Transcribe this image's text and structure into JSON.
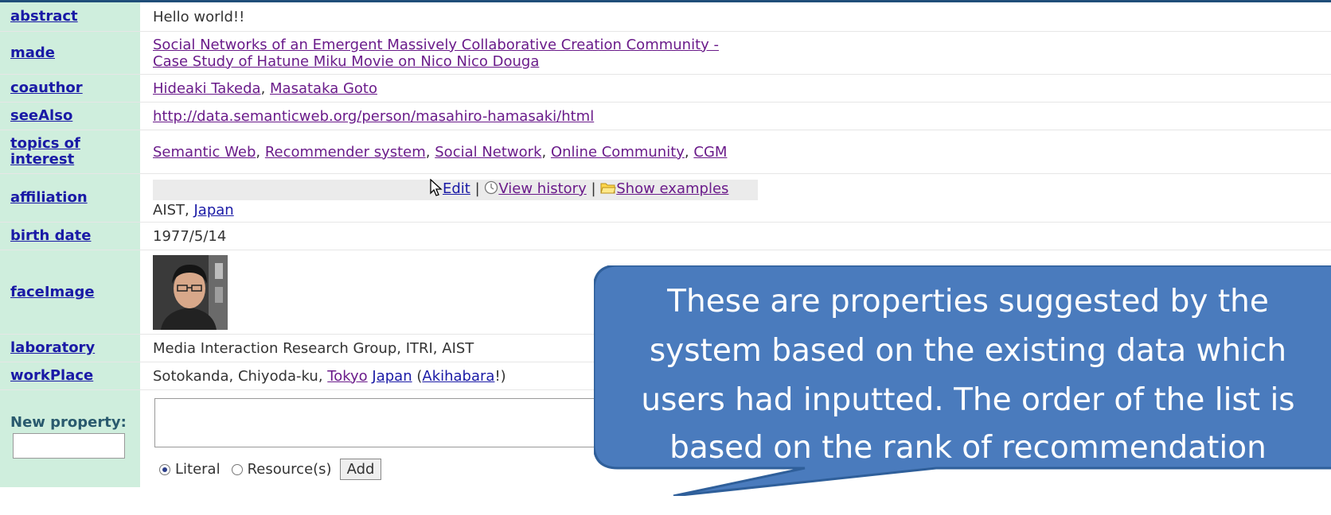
{
  "rows": {
    "abstract": {
      "label": "abstract",
      "value": "Hello world!!"
    },
    "made": {
      "label": "made",
      "line1": "Social Networks of an Emergent Massively Collaborative Creation Community -",
      "line2": "Case Study of Hatune Miku Movie on Nico Nico Douga"
    },
    "coauthor": {
      "label": "coauthor",
      "a1": "Hideaki Takeda",
      "sep": ", ",
      "a2": "Masataka Goto"
    },
    "seeAlso": {
      "label": "seeAlso",
      "url": "http://data.semanticweb.org/person/masahiro-hamasaki/html"
    },
    "topics": {
      "label_line1": "topics of",
      "label_line2": "interest",
      "t1": "Semantic Web",
      "t2": "Recommender system",
      "t3": "Social Network",
      "t4": "Online Community",
      "t5": "CGM",
      "sep": ", "
    },
    "affiliation": {
      "label": "affiliation",
      "edit": "Edit",
      "view_history": "View history",
      "show_examples": "Show examples",
      "pipe": " | ",
      "text": "AIST, ",
      "link": "Japan"
    },
    "birth_date": {
      "label": "birth date",
      "value": "1977/5/14"
    },
    "faceImage": {
      "label": "faceImage"
    },
    "laboratory": {
      "label": "laboratory",
      "value": "Media Interaction Research Group, ITRI, AIST"
    },
    "workPlace": {
      "label": "workPlace",
      "text": "Sotokanda, Chiyoda-ku, ",
      "link1": "Tokyo",
      "space": " ",
      "link2": "Japan",
      "paren_open": " (",
      "link3": "Akihabara",
      "paren_close": "!)"
    },
    "new_property": {
      "label": "New property:",
      "literal": "Literal",
      "resource": "Resource(s)",
      "add": "Add"
    }
  },
  "callout": {
    "line1": "These are properties suggested by the",
    "line2": "system based on the existing data which",
    "line3": "users had inputted. The order of the list is",
    "line4": "based on the rank of recommendation",
    "fill": "#4a7bbd",
    "stroke": "#2f5f9a",
    "text_color": "#ffffff"
  },
  "colors": {
    "label_bg": "#cfeedd",
    "link": "#1a1aa6",
    "visited_link": "#6a1b8a",
    "top_bar": "#1f4e79"
  }
}
